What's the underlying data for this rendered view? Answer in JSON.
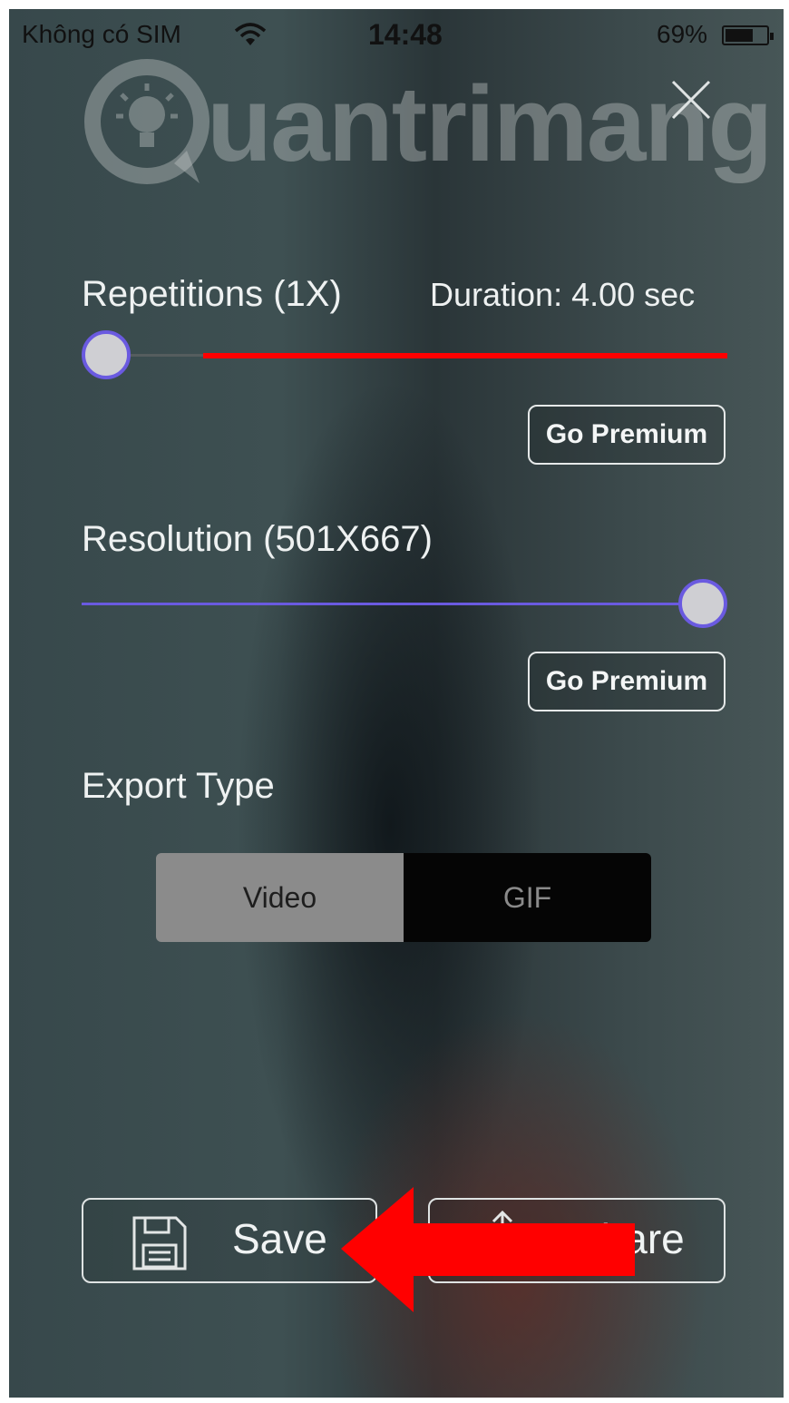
{
  "status_bar": {
    "carrier": "Không có SIM",
    "time": "14:48",
    "battery_percent": "69%",
    "battery_level": 0.69
  },
  "watermark": {
    "brand": "Quantrimang",
    "visible_text": "uantrimang"
  },
  "settings": {
    "repetitions_label": "Repetitions (1X)",
    "duration_label": "Duration: 4.00 sec",
    "repetitions_value": 0.0,
    "resolution_label": "Resolution (501X667)",
    "resolution_value": 1.0,
    "premium_label_1": "Go Premium",
    "premium_label_2": "Go Premium",
    "export_type_label": "Export Type",
    "export_options": [
      "Video",
      "GIF"
    ],
    "export_selected": "Video"
  },
  "actions": {
    "save_label": "Save",
    "share_label": "Share"
  },
  "colors": {
    "slider_thumb_border": "#6a5ae0",
    "repetitions_track_active": "#ff0000",
    "resolution_track": "#6a5ae0",
    "annotation_arrow": "#ff0000",
    "segment_selected": "#8b8b8b",
    "segment_unselected": "#050505"
  },
  "icons": {
    "close": "close-icon",
    "save": "floppy-disk-icon",
    "share": "share-icon",
    "wifi": "wifi-icon",
    "battery": "battery-icon",
    "logo": "lightbulb-logo-icon"
  }
}
